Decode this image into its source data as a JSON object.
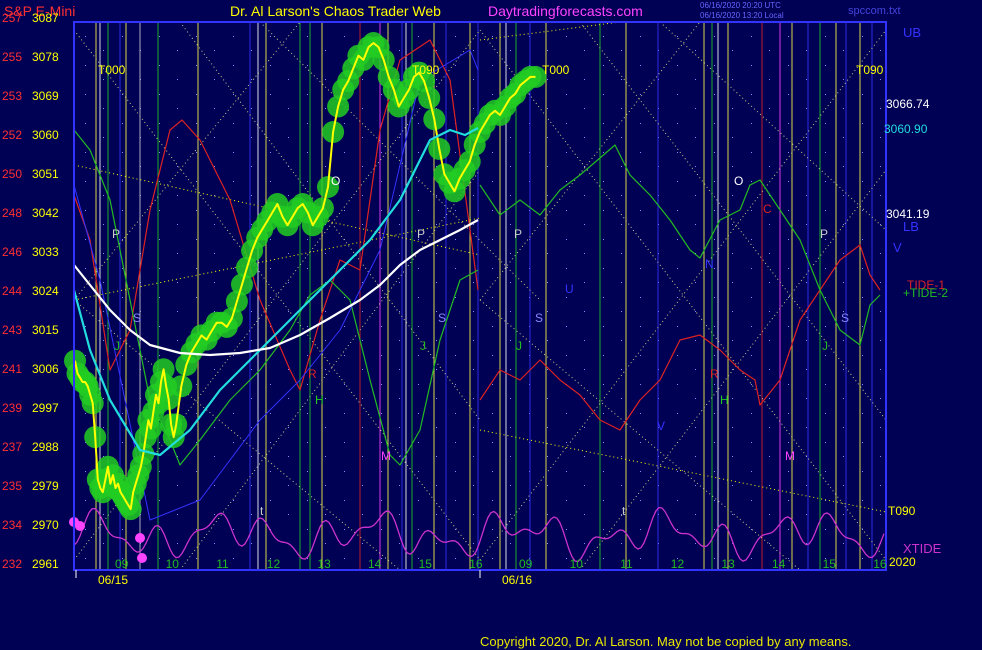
{
  "header": {
    "instrument": "S&P E-Mini",
    "title": "Dr. Al Larson's Chaos Trader Web",
    "site": "Daytradingforecasts.com",
    "stamp1": "06/16/2020 20:20 UTC",
    "stamp2": "06/16/2020 13:20 Local",
    "file": "spccom.txt"
  },
  "left_axis": [
    {
      "a": "257",
      "b": "3087"
    },
    {
      "a": "255",
      "b": "3078"
    },
    {
      "a": "253",
      "b": "3069"
    },
    {
      "a": "252",
      "b": "3060"
    },
    {
      "a": "250",
      "b": "3051"
    },
    {
      "a": "248",
      "b": "3042"
    },
    {
      "a": "246",
      "b": "3033"
    },
    {
      "a": "244",
      "b": "3024"
    },
    {
      "a": "243",
      "b": "3015"
    },
    {
      "a": "241",
      "b": "3006"
    },
    {
      "a": "239",
      "b": "2997"
    },
    {
      "a": "237",
      "b": "2988"
    },
    {
      "a": "235",
      "b": "2979"
    },
    {
      "a": "234",
      "b": "2970"
    },
    {
      "a": "232",
      "b": "2961"
    }
  ],
  "right_labels": {
    "ub": "UB",
    "lb": "LB",
    "v": "V",
    "p1": "3066.74",
    "p2": "3060.90",
    "p3": "3041.19",
    "tide1": "TIDE-1",
    "tide2": "+TIDE-2",
    "t090": "T090",
    "xtide": "XTIDE",
    "year": "2020"
  },
  "x_axis": {
    "hours_day1": [
      "09",
      "10",
      "11",
      "12",
      "13",
      "14",
      "15",
      "16"
    ],
    "hours_day2": [
      "09",
      "10",
      "11",
      "12",
      "13",
      "14",
      "15",
      "16"
    ],
    "date1": "06/15",
    "date2": "06/16"
  },
  "chart_labels": {
    "t000": "T000",
    "t090": "T090",
    "p": "P",
    "s": "S",
    "j": "J",
    "h": "H",
    "m": "M",
    "o": "O",
    "n": "N",
    "u": "U",
    "v": "V",
    "c": "C",
    "r": "R",
    "t": "t"
  },
  "copyright": "Copyright 2020, Dr. Al Larson. May not be copied by any means.",
  "colors": {
    "background": "#000055",
    "frame": "#3333ff",
    "price": "#ffff00",
    "ma_cyan": "#22dddd",
    "ma_white": "#ffffff",
    "glow": "#22cc22",
    "tide1": "#dd2222",
    "tide2": "#22bb22",
    "xtide": "#cc33cc",
    "text_red": "#ff3030",
    "text_magenta": "#ff44ff"
  },
  "chart_data": {
    "type": "line",
    "title": "S&P E-Mini",
    "y_primary_range": [
      2961,
      3087
    ],
    "y_secondary_range": [
      232,
      257
    ],
    "levels": [
      3066.74,
      3060.9,
      3041.19
    ],
    "series": [
      {
        "name": "price",
        "x": [
          0,
          0.05,
          0.1,
          0.15,
          0.2,
          0.25,
          0.3,
          0.35,
          0.4,
          0.45,
          0.5,
          0.55,
          0.6,
          0.65,
          0.7,
          0.75,
          0.8,
          0.85,
          0.9,
          0.95,
          1.0,
          1.05,
          1.1,
          1.15,
          1.2,
          1.25,
          1.3,
          1.35,
          1.4,
          1.45,
          1.5,
          1.55,
          1.6,
          1.65,
          1.7,
          1.75,
          1.8,
          1.85,
          1.9,
          1.95,
          2.0,
          2.1,
          2.2,
          2.3,
          2.4,
          2.5,
          2.6,
          2.7,
          2.8,
          2.9,
          3.0,
          3.1,
          3.2,
          3.3,
          3.4,
          3.5,
          3.6,
          3.7,
          3.8,
          3.9,
          4.0,
          4.1,
          4.2,
          4.3,
          4.4,
          4.5,
          4.6,
          4.7,
          4.8,
          4.9,
          5.0,
          5.1,
          5.2,
          5.3,
          5.4,
          5.5,
          5.6,
          5.7,
          5.8,
          5.9,
          6.0,
          6.1,
          6.2,
          6.3,
          6.4,
          6.5,
          6.6,
          6.7,
          6.8,
          6.9,
          7.0,
          7.1,
          7.2,
          7.3,
          7.4,
          7.5,
          7.6,
          7.7,
          7.8,
          7.9,
          8.0,
          8.1,
          8.2,
          8.3,
          8.4,
          8.5,
          8.6,
          8.7,
          8.8,
          8.9,
          9.0,
          9.1
        ],
        "values": [
          3008,
          3005,
          3004,
          3003,
          3003,
          3002,
          3000,
          2998,
          2990,
          2980,
          2978,
          2977,
          2980,
          2983,
          2979,
          2981,
          2978,
          2979,
          2977,
          2976,
          2975,
          2974,
          2973,
          2977,
          2979,
          2981,
          2983,
          2986,
          2990,
          2994,
          2992,
          2996,
          3000,
          2998,
          3003,
          3006,
          3002,
          2999,
          2993,
          2990,
          2993,
          3002,
          3007,
          3010,
          3012,
          3014,
          3013,
          3015,
          3017,
          3017,
          3016,
          3018,
          3022,
          3026,
          3030,
          3034,
          3037,
          3039,
          3041,
          3043,
          3045,
          3042,
          3040,
          3042,
          3044,
          3045,
          3043,
          3040,
          3042,
          3044,
          3049,
          3062,
          3068,
          3072,
          3074,
          3077,
          3080,
          3079,
          3082,
          3083,
          3082,
          3079,
          3075,
          3072,
          3068,
          3070,
          3072,
          3075,
          3076,
          3074,
          3070,
          3065,
          3058,
          3052,
          3050,
          3048,
          3051,
          3053,
          3055,
          3059,
          3062,
          3064,
          3066,
          3067,
          3066,
          3068,
          3070,
          3071,
          3073,
          3074,
          3075,
          3075
        ]
      },
      {
        "name": "TIDE-1",
        "note": "red"
      },
      {
        "name": "+TIDE-2",
        "note": "green"
      },
      {
        "name": "XTIDE",
        "note": "magenta"
      }
    ]
  }
}
